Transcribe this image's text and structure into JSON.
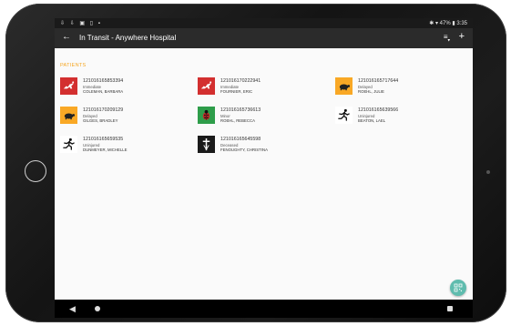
{
  "status_bar": {
    "left_icons": "⇩ ⇩ ▣ ▯ ▪",
    "right_text": "✱ ▾ 47% ▮ 3:35"
  },
  "app_bar": {
    "title": "In Transit - Anywhere Hospital",
    "back_icon": "arrow-back-icon",
    "filter_icon": "filter-icon",
    "add_icon": "plus-icon"
  },
  "section": {
    "title": "PATIENTS"
  },
  "colors": {
    "immediate": "#d32f2f",
    "delayed": "#f9a825",
    "minor": "#2e9d4a",
    "deceased": "#1a1a1a",
    "uninjured": "#ffffff",
    "accent": "#f5a623",
    "fab": "#5fbcae"
  },
  "patients": [
    {
      "id": "121016165853394",
      "status": "Immediate",
      "name": "COLEMAN, BARBARA",
      "tag": "immediate"
    },
    {
      "id": "121016170222941",
      "status": "Immediate",
      "name": "FOURNIER, ERIC",
      "tag": "immediate"
    },
    {
      "id": "121016165717644",
      "status": "Delayed",
      "name": "ROEHL, JULIE",
      "tag": "delayed"
    },
    {
      "id": "121016170209129",
      "status": "Delayed",
      "name": "GILGES, BRADLEY",
      "tag": "delayed"
    },
    {
      "id": "121016165736613",
      "status": "Minor",
      "name": "ROEHL, REBECCA",
      "tag": "minor"
    },
    {
      "id": "121016165639566",
      "status": "Uninjured",
      "name": "BEATON, LAEL",
      "tag": "uninjured"
    },
    {
      "id": "121016165659535",
      "status": "Uninjured",
      "name": "DUNMEYER, MICHELLE",
      "tag": "uninjured"
    },
    {
      "id": "121016165645598",
      "status": "Deceased",
      "name": "FENOUGHTY, CHRISTINA",
      "tag": "deceased"
    }
  ]
}
